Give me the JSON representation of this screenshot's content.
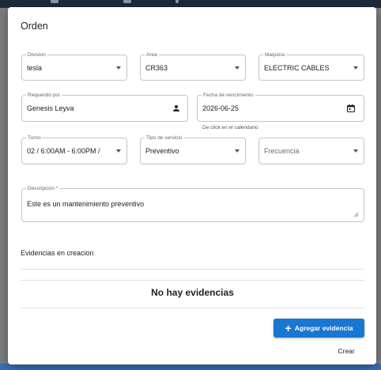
{
  "dialog": {
    "title": "Orden",
    "fields": {
      "division": {
        "label": "Division",
        "value": "tesla"
      },
      "area": {
        "label": "Area",
        "value": "CR363"
      },
      "maquina": {
        "label": "Maquina",
        "value": "ELECTRIC CABLES"
      },
      "requerido_por": {
        "label": "Requerido por",
        "value": "Genesis Leyva",
        "icon": "person-icon"
      },
      "fecha_vencimiento": {
        "label": "Fecha de vencimiento",
        "value": "2026-06-25",
        "helper": "De click en el calendario",
        "icon": "calendar-icon"
      },
      "turno": {
        "label": "Turno",
        "value": "02 / 6:00AM - 6:00PM /"
      },
      "tipo_servicio": {
        "label": "Tipo de servicio",
        "value": "Preventivo"
      },
      "frecuencia": {
        "placeholder": "Frecuencia"
      },
      "descripcion": {
        "label": "Descripcion *",
        "value": "Este es un mantenimiento preventivo"
      }
    },
    "evidencias": {
      "section_label": "Evidencias en creacion",
      "empty_text": "No hay evidencias"
    },
    "buttons": {
      "add_evidence": "Agregar evidencia",
      "create": "Crear"
    }
  },
  "colors": {
    "primary": "#1976d2",
    "overlay": "#7d7d7d"
  }
}
